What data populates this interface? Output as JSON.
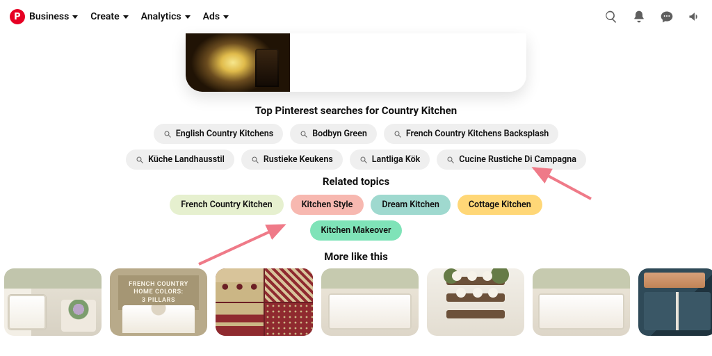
{
  "nav": {
    "items": [
      {
        "label": "Business"
      },
      {
        "label": "Create"
      },
      {
        "label": "Analytics"
      },
      {
        "label": "Ads"
      }
    ]
  },
  "sections": {
    "top_searches_title": "Top Pinterest searches for Country Kitchen",
    "related_title": "Related topics",
    "more_title": "More like this"
  },
  "top_searches": [
    "English Country Kitchens",
    "Bodbyn Green",
    "French Country Kitchens Backsplash",
    "Küche Landhausstil",
    "Rustieke Keukens",
    "Lantliga Kök",
    "Cucine Rustiche Di Campagna"
  ],
  "related_topics": [
    {
      "label": "French Country Kitchen",
      "bg": "#e6f0cf"
    },
    {
      "label": "Kitchen Style",
      "bg": "#f7b8b0"
    },
    {
      "label": "Dream Kitchen",
      "bg": "#9fd9cf"
    },
    {
      "label": "Cottage Kitchen",
      "bg": "#ffd777"
    },
    {
      "label": "Kitchen Makeover",
      "bg": "#7fe3b8"
    }
  ],
  "thumb2_overlay": "FRENCH COUNTRY\nHOME COLORS:\n3 PILLARS",
  "annotation_arrow_color": "#ef7a88"
}
